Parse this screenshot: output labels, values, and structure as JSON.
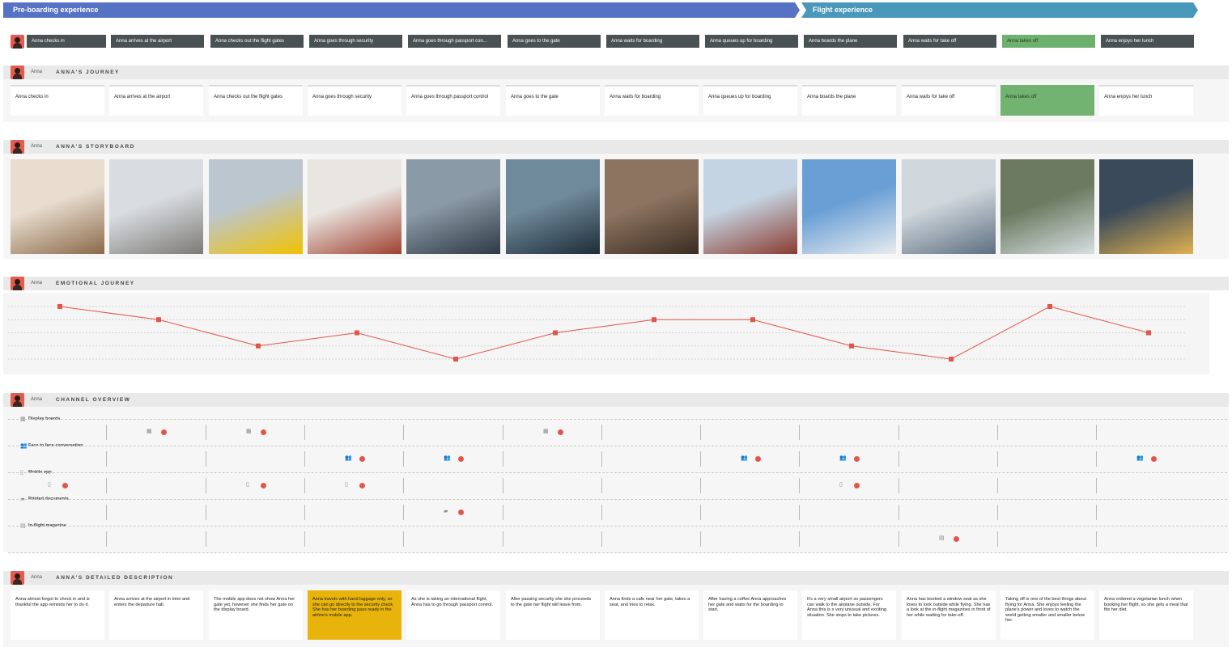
{
  "phases": {
    "pre": "Pre-boarding experience",
    "flight": "Flight experience"
  },
  "steps": [
    "Anna checks in",
    "Anna arrives at the airport",
    "Anna checks out the flight gates",
    "Anna goes through security",
    "Anna goes through passport con...",
    "Anna goes to the gate",
    "Anna waits for boarding",
    "Anna queues up for boarding",
    "Anna boards the plane",
    "Anna waits for take off",
    "Anna takes off",
    "Anna enjoys her lunch"
  ],
  "highlight_step_index": 10,
  "sections": {
    "journey": {
      "user": "Anna",
      "title": "ANNA'S JOURNEY"
    },
    "storyboard": {
      "user": "Anna",
      "title": "ANNA'S STORYBOARD"
    },
    "emotional": {
      "user": "Anna",
      "title": "EMOTIONAL JOURNEY"
    },
    "channels": {
      "user": "Anna",
      "title": "CHANNEL OVERVIEW"
    },
    "description": {
      "user": "Anna",
      "title": "ANNA'S DETAILED DESCRIPTION"
    }
  },
  "journey_cards": [
    "Anna checks in",
    "Anna arrives at the airport",
    "Anna checks out the flight gates",
    "Anna goes through security",
    "Anna goes through passport control",
    "Anna goes to the gate",
    "Anna waits for boarding",
    "Anna queues up for boarding",
    "Anna boards the plane",
    "Anna waits for take off",
    "Anna takes off",
    "Anna enjoys her lunch"
  ],
  "storyboard_images": [
    {
      "icon": "check-in-photo",
      "colors": [
        "#e8ddcf",
        "#8a6a4a"
      ]
    },
    {
      "icon": "airport-hall-photo",
      "colors": [
        "#d9dde1",
        "#7d7a76"
      ]
    },
    {
      "icon": "departures-board-photo",
      "colors": [
        "#bcc6cf",
        "#f2c200"
      ]
    },
    {
      "icon": "security-scanner-photo",
      "colors": [
        "#e9e6e1",
        "#a04030"
      ]
    },
    {
      "icon": "passport-control-photo",
      "colors": [
        "#8a9aa6",
        "#2e3a45"
      ]
    },
    {
      "icon": "gate-hall-photo",
      "colors": [
        "#6f8a9a",
        "#1e2c38"
      ]
    },
    {
      "icon": "cafe-waiting-photo",
      "colors": [
        "#8d7460",
        "#3a2c22"
      ]
    },
    {
      "icon": "boarding-queue-photo",
      "colors": [
        "#c4d4e2",
        "#8a3b30"
      ]
    },
    {
      "icon": "airplane-stairs-photo",
      "colors": [
        "#6a9fd6",
        "#e8ecef"
      ]
    },
    {
      "icon": "cabin-seats-photo",
      "colors": [
        "#cfd6dc",
        "#5e6f80"
      ]
    },
    {
      "icon": "plane-taking-off-photo",
      "colors": [
        "#6b7a60",
        "#d8dfe3"
      ]
    },
    {
      "icon": "inflight-meal-photo",
      "colors": [
        "#3a4a5a",
        "#e0b050"
      ]
    }
  ],
  "chart_data": {
    "type": "line",
    "x": [
      1,
      2,
      3,
      4,
      5,
      6,
      7,
      8,
      9,
      10,
      11,
      12
    ],
    "series": [
      {
        "values": [
          5,
          4,
          2,
          3,
          1,
          3,
          4,
          4,
          2,
          1,
          5,
          3
        ]
      }
    ],
    "ylim": [
      1,
      5
    ],
    "grid": true,
    "color": "#e1554a"
  },
  "channels": {
    "rows": [
      {
        "label": "Display boards",
        "icon": "display-board-icon",
        "glyph": "▦",
        "hits": [
          1,
          2,
          5
        ]
      },
      {
        "label": "Face to face conversation",
        "icon": "people-icon",
        "glyph": "👥",
        "hits": [
          3,
          4,
          7,
          8,
          11
        ]
      },
      {
        "label": "Mobile app",
        "icon": "mobile-icon",
        "glyph": "▯",
        "hits": [
          0,
          2,
          3,
          8
        ]
      },
      {
        "label": "Printed documents",
        "icon": "document-icon",
        "glyph": "▰",
        "hits": [
          4
        ]
      },
      {
        "label": "In-flight magazine",
        "icon": "magazine-icon",
        "glyph": "▤",
        "hits": [
          9
        ]
      }
    ]
  },
  "descriptions": [
    "Anna almost forgot to check in and is thankful the app reminds her to do it.",
    "Anna arrives at the airport in time and enters the departure hall.",
    "The mobile app does not show Anna her gate yet, however she finds her gate on the display board.",
    "Anna travels with hand luggage only, so she can go directly to the security check. She has her boarding pass ready in the airline's mobile app.",
    "As she is taking an international flight, Anna has to go through passport control.",
    "After passing security she she proceeds to the gate her flight will leave from.",
    "Anna finds a cafe near her gate, takes a seat, and tries to relax.",
    "After having a coffee Anna approaches her gate and waits for the boarding to start.",
    "It's a very small airport so passengers can walk to the airplane outside. For Anna this is s very unusual and exciting situation. She stops to take pictures.",
    "Anna has booked a window seat as she loves to look outside while flying. She has a look at the in-flight magazines in front of her while waiting for take-off.",
    "Taking off is one of the best things about flying for Anna. She enjoys feeling the plane's power and loves to watch the world getting smaller and smaller below her.",
    "Anna ordered a vegetarian lunch when booking her flight, so she gets a meal that fits her diet."
  ],
  "highlight_description_index": 3
}
